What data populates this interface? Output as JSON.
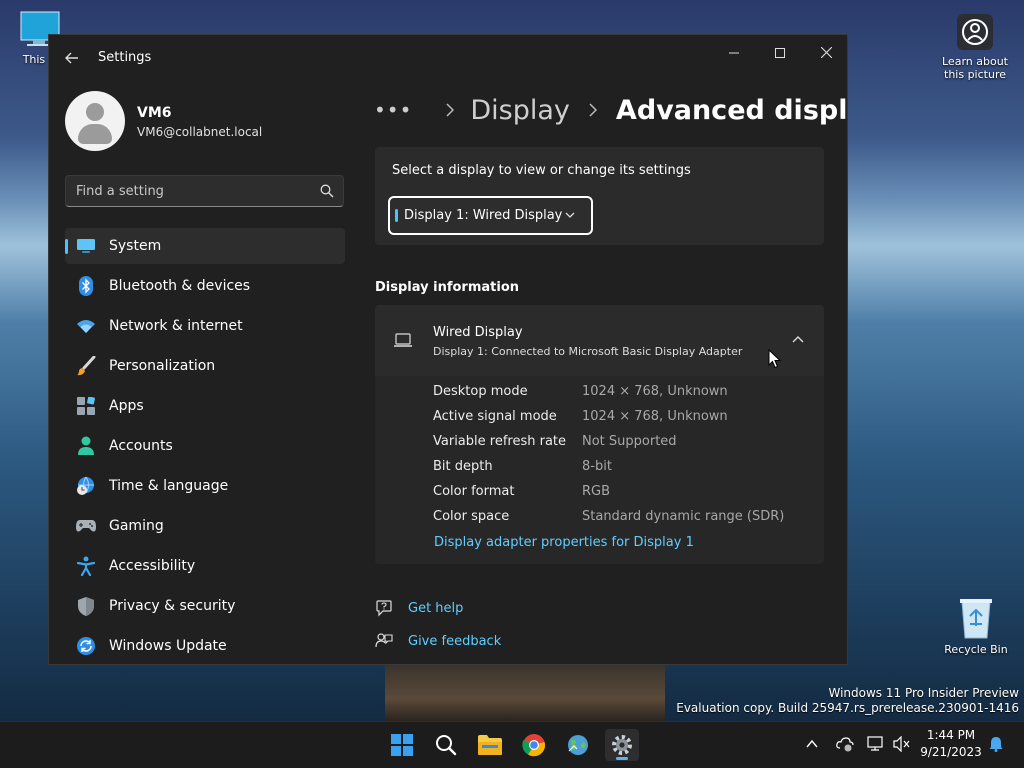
{
  "desktop": {
    "this_pc_label": "This P",
    "learn_label_1": "Learn about",
    "learn_label_2": "this picture",
    "recycle_bin_label": "Recycle Bin",
    "watermark_line1": "Windows 11 Pro Insider Preview",
    "watermark_line2": "Evaluation copy. Build 25947.rs_prerelease.230901-1416"
  },
  "window": {
    "title": "Settings",
    "controls": {
      "minimize": "—",
      "maximize": "☐",
      "close": "✕"
    }
  },
  "user": {
    "name": "VM6",
    "email": "VM6@collabnet.local"
  },
  "search": {
    "placeholder": "Find a setting",
    "value": ""
  },
  "sidebar": {
    "items": [
      {
        "label": "System",
        "icon": "monitor-icon",
        "active": true
      },
      {
        "label": "Bluetooth & devices",
        "icon": "bluetooth-icon"
      },
      {
        "label": "Network & internet",
        "icon": "wifi-icon"
      },
      {
        "label": "Personalization",
        "icon": "brush-icon"
      },
      {
        "label": "Apps",
        "icon": "apps-icon"
      },
      {
        "label": "Accounts",
        "icon": "person-icon"
      },
      {
        "label": "Time & language",
        "icon": "globe-clock-icon"
      },
      {
        "label": "Gaming",
        "icon": "gamepad-icon"
      },
      {
        "label": "Accessibility",
        "icon": "accessibility-icon"
      },
      {
        "label": "Privacy & security",
        "icon": "shield-icon"
      },
      {
        "label": "Windows Update",
        "icon": "update-icon"
      }
    ]
  },
  "breadcrumb": {
    "more": "•••",
    "parent": "Display",
    "current": "Advanced display"
  },
  "display_select": {
    "label": "Select a display to view or change its settings",
    "selected": "Display 1: Wired Display"
  },
  "display_info": {
    "section_title": "Display information",
    "title": "Wired Display",
    "subtitle": "Display 1: Connected to Microsoft Basic Display Adapter",
    "expanded": true,
    "rows": [
      {
        "key": "Desktop mode",
        "value": "1024 × 768, Unknown"
      },
      {
        "key": "Active signal mode",
        "value": "1024 × 768, Unknown"
      },
      {
        "key": "Variable refresh rate",
        "value": "Not Supported"
      },
      {
        "key": "Bit depth",
        "value": "8-bit"
      },
      {
        "key": "Color format",
        "value": "RGB"
      },
      {
        "key": "Color space",
        "value": "Standard dynamic range (SDR)"
      }
    ],
    "adapter_link": "Display adapter properties for Display 1"
  },
  "help": {
    "get_help": "Get help",
    "give_feedback": "Give feedback"
  },
  "taskbar": {
    "apps": [
      {
        "name": "start-button",
        "icon": "windows-logo-icon"
      },
      {
        "name": "search-button",
        "icon": "search-icon"
      },
      {
        "name": "file-explorer-button",
        "icon": "folder-icon"
      },
      {
        "name": "chrome-button",
        "icon": "chrome-icon"
      },
      {
        "name": "globe-app-button",
        "icon": "globe-icon"
      },
      {
        "name": "settings-app-button",
        "icon": "gear-icon",
        "active": true
      }
    ],
    "time": "1:44 PM",
    "date": "9/21/2023"
  },
  "colors": {
    "accent": "#4cc2ff",
    "link": "#60cdff",
    "window_bg": "#202020",
    "card_bg": "#2b2b2b"
  }
}
